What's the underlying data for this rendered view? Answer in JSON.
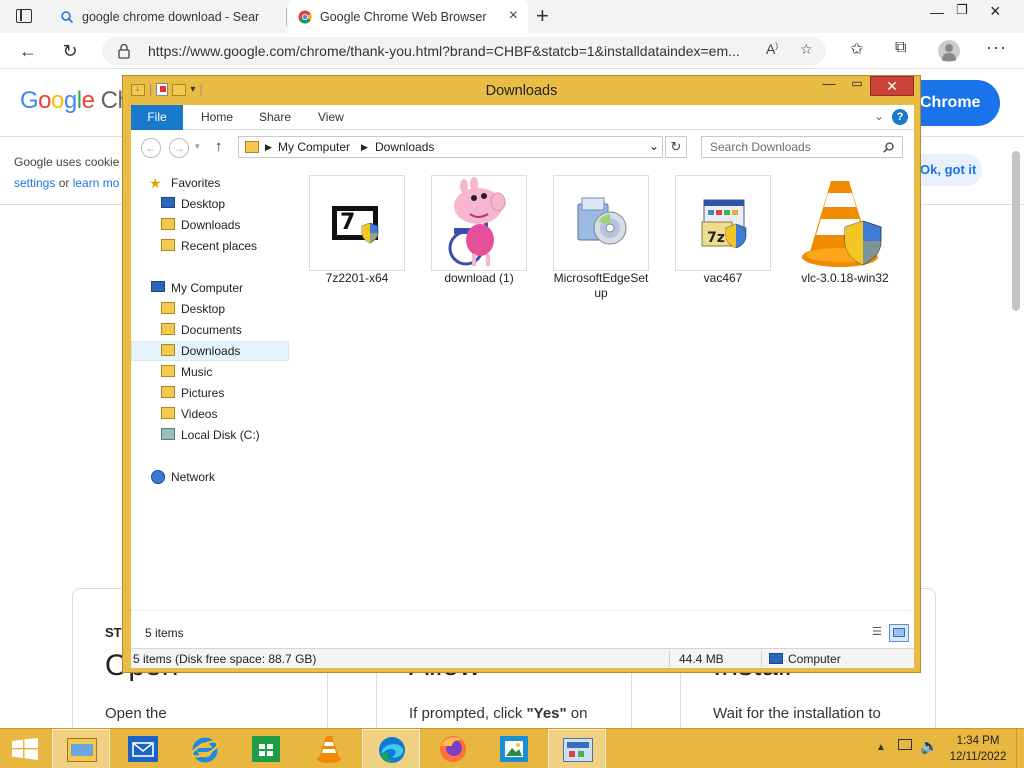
{
  "browser": {
    "tabs": [
      {
        "title": "google chrome download - Sear",
        "active": false
      },
      {
        "title": "Google Chrome Web Browser",
        "active": true
      }
    ],
    "new_tab_symbol": "+",
    "url": "https://www.google.com/chrome/thank-you.html?brand=CHBF&statcb=1&installdataindex=em..."
  },
  "webpage": {
    "logo": {
      "g1": "G",
      "o1": "o",
      "o2": "o",
      "g2": "g",
      "l": "l",
      "e": "e",
      "after": "Ch"
    },
    "download_button": "Chrome",
    "cookie_line1": "Google uses cookie",
    "cookie_link1": "settings",
    "cookie_or": "or",
    "cookie_link2": "learn mo",
    "ok_button": "Ok, got it",
    "cards": [
      {
        "step": "ST",
        "heading": "Open",
        "desc": "Open the"
      },
      {
        "heading": "Allow",
        "desc_pre": "If prompted, click ",
        "desc_bold": "\"Yes\"",
        "desc_post": " on"
      },
      {
        "heading": "Install",
        "desc": "Wait for the installation to"
      }
    ]
  },
  "explorer": {
    "title": "Downloads",
    "ribbon_tabs": [
      "File",
      "Home",
      "Share",
      "View"
    ],
    "path": [
      "My Computer",
      "Downloads"
    ],
    "search_placeholder": "Search Downloads",
    "nav": {
      "favorites": "Favorites",
      "favorites_items": [
        "Desktop",
        "Downloads",
        "Recent places"
      ],
      "computer": "My Computer",
      "computer_items": [
        "Desktop",
        "Documents",
        "Downloads",
        "Music",
        "Pictures",
        "Videos",
        "Local Disk (C:)"
      ],
      "network": "Network",
      "selected": "Downloads"
    },
    "files": [
      {
        "name": "7z2201-x64",
        "icon": "7zip-installer-icon"
      },
      {
        "name": "download (1)",
        "icon": "image-thumbnail-icon"
      },
      {
        "name": "MicrosoftEdgeSetup",
        "icon": "setup-cd-icon"
      },
      {
        "name": "vac467",
        "icon": "7zip-installer-icon"
      },
      {
        "name": "vlc-3.0.18-win32",
        "icon": "vlc-cone-icon"
      }
    ],
    "item_count": "5 items",
    "status_detail": "5 items (Disk free space: 88.7 GB)",
    "status_size": "44.4 MB",
    "status_location": "Computer"
  },
  "taskbar": {
    "apps": [
      "file-explorer",
      "mail",
      "internet-explorer",
      "store",
      "vlc",
      "edge",
      "firefox",
      "photos",
      "control-panel"
    ],
    "time": "1:34 PM",
    "date": "12/11/2022"
  }
}
